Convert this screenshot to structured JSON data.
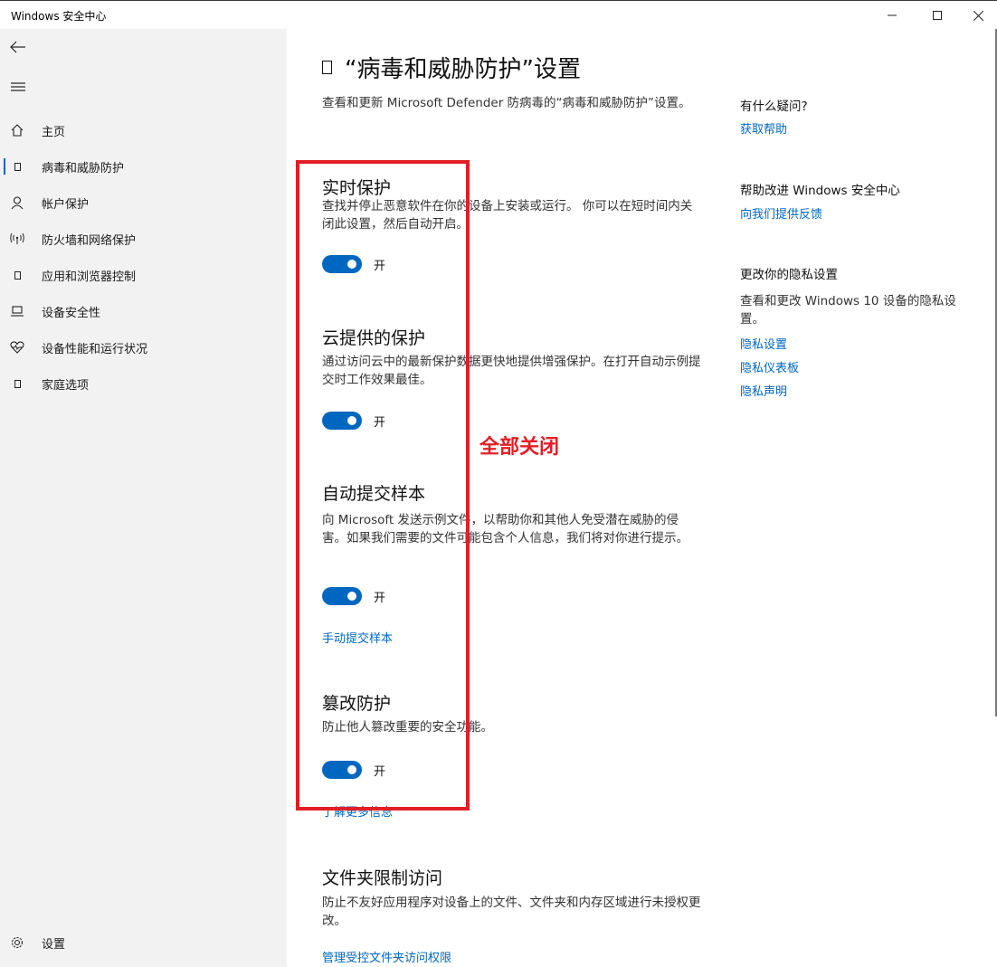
{
  "window": {
    "title": "Windows 安全中心"
  },
  "sidebar": {
    "items": [
      {
        "label": "主页",
        "icon": "home-icon"
      },
      {
        "label": "病毒和威胁防护",
        "icon": "virus-protection-icon",
        "active": true
      },
      {
        "label": "帐户保护",
        "icon": "account-icon"
      },
      {
        "label": "防火墙和网络保护",
        "icon": "firewall-icon"
      },
      {
        "label": "应用和浏览器控制",
        "icon": "app-browser-icon"
      },
      {
        "label": "设备安全性",
        "icon": "device-security-icon"
      },
      {
        "label": "设备性能和运行状况",
        "icon": "heart-icon"
      },
      {
        "label": "家庭选项",
        "icon": "family-icon"
      }
    ],
    "settings_label": "设置"
  },
  "main": {
    "title": "“病毒和威胁防护”设置",
    "description": "查看和更新 Microsoft Defender 防病毒的“病毒和威胁防护”设置。",
    "sections": [
      {
        "title": "实时保护",
        "description": "查找并停止恶意软件在你的设备上安装或运行。 你可以在短时间内关闭此设置，然后自动开启。",
        "toggle_label": "开",
        "toggle_on": true
      },
      {
        "title": "云提供的保护",
        "description": "通过访问云中的最新保护数据更快地提供增强保护。在打开自动示例提交时工作效果最佳。",
        "toggle_label": "开",
        "toggle_on": true
      },
      {
        "title": "自动提交样本",
        "description": "向 Microsoft 发送示例文件，以帮助你和其他人免受潜在威胁的侵害。如果我们需要的文件可能包含个人信息，我们将对你进行提示。",
        "toggle_label": "开",
        "toggle_on": true,
        "link": "手动提交样本"
      },
      {
        "title": "篡改防护",
        "description": "防止他人篡改重要的安全功能。",
        "toggle_label": "开",
        "toggle_on": true,
        "link": "了解更多信息"
      },
      {
        "title": "文件夹限制访问",
        "description": "防止不友好应用程序对设备上的文件、文件夹和内存区域进行未授权更改。",
        "link": "管理受控文件夹访问权限"
      }
    ]
  },
  "side_panel": {
    "questions": {
      "heading": "有什么疑问?",
      "link": "获取帮助"
    },
    "improve": {
      "heading": "帮助改进 Windows 安全中心",
      "link": "向我们提供反馈"
    },
    "privacy": {
      "heading": "更改你的隐私设置",
      "text": "查看和更改 Windows 10 设备的隐私设置。",
      "links": [
        "隐私设置",
        "隐私仪表板",
        "隐私声明"
      ]
    }
  },
  "annotation": {
    "note": "全部关闭",
    "color": "#e31e24"
  },
  "colors": {
    "accent": "#0067c0",
    "sidebar_bg": "#f2f2f2"
  }
}
